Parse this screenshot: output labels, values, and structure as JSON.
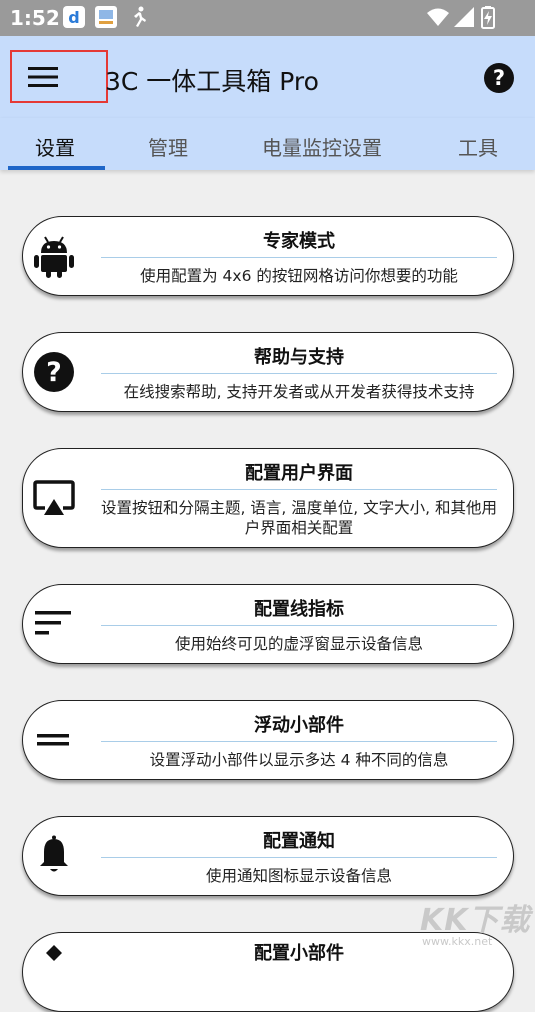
{
  "status_bar": {
    "time": "1:52",
    "icons": [
      "d-app-icon",
      "image-app-icon",
      "running-figure-icon",
      "wifi-icon",
      "signal-icon",
      "battery-charging-icon"
    ]
  },
  "app_bar": {
    "title": "3C 一体工具箱 Pro",
    "menu_icon": "hamburger-menu-icon",
    "help_icon": "help-circle-icon",
    "highlight_color": "#e53935"
  },
  "tabs": [
    {
      "label": "设置",
      "active": true
    },
    {
      "label": "管理",
      "active": false
    },
    {
      "label": "电量监控设置",
      "active": false
    },
    {
      "label": "工具",
      "active": false
    }
  ],
  "cards": [
    {
      "icon": "android-icon",
      "title": "专家模式",
      "description": "使用配置为 4x6 的按钮网格访问你想要的功能"
    },
    {
      "icon": "help-circle-icon",
      "title": "帮助与支持",
      "description": "在线搜索帮助, 支持开发者或从开发者获得技术支持"
    },
    {
      "icon": "cast-screen-icon",
      "title": "配置用户界面",
      "description": "设置按钮和分隔主题, 语言, 温度单位, 文字大小, 和其他用户界面相关配置"
    },
    {
      "icon": "sort-lines-icon",
      "title": "配置线指标",
      "description": "使用始终可见的虚浮窗显示设备信息"
    },
    {
      "icon": "equal-lines-icon",
      "title": "浮动小部件",
      "description": "设置浮动小部件以显示多达 4 种不同的信息"
    },
    {
      "icon": "bell-icon",
      "title": "配置通知",
      "description": "使用通知图标显示设备信息"
    },
    {
      "icon": "widget-icon",
      "title": "配置小部件",
      "description": ""
    }
  ],
  "watermark": {
    "logo": "KK下载",
    "url": "www.kkx.net"
  },
  "colors": {
    "app_bar": "#c6dcfb",
    "tab_indicator": "#1e66c8",
    "background": "#efefef",
    "separator": "#a9cde8"
  }
}
